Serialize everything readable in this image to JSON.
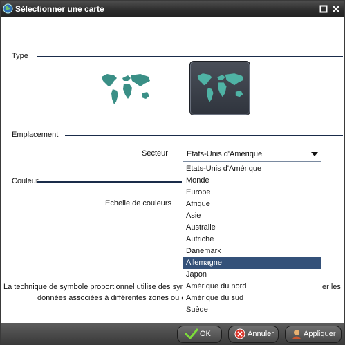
{
  "window": {
    "title": "Sélectionner une carte"
  },
  "sections": {
    "type": "Type",
    "location": "Emplacement",
    "color": "Couleur"
  },
  "sector": {
    "label": "Secteur",
    "selected_value": "Etats-Unis d'Amérique",
    "options": [
      "Etats-Unis d'Amérique",
      "Monde",
      "Europe",
      "Afrique",
      "Asie",
      "Australie",
      "Autriche",
      "Danemark",
      "Allemagne",
      "Japon",
      "Amérique du nord",
      "Amérique du sud",
      "Suède"
    ],
    "highlighted": "Allemagne"
  },
  "color_scale": {
    "label": "Echelle de couleurs"
  },
  "description": {
    "line1_start": "La technique de symbole proportionnel utilise des sym",
    "line1_end": "er les",
    "line2": "données associées à différentes zones ou e"
  },
  "buttons": {
    "ok": "OK",
    "cancel": "Annuler",
    "apply": "Appliquer"
  },
  "colors": {
    "title_bar": "#2b2b2b",
    "section_rule": "#1a2c4a",
    "list_highlight": "#345179",
    "map_teal": "#3a8f86"
  }
}
